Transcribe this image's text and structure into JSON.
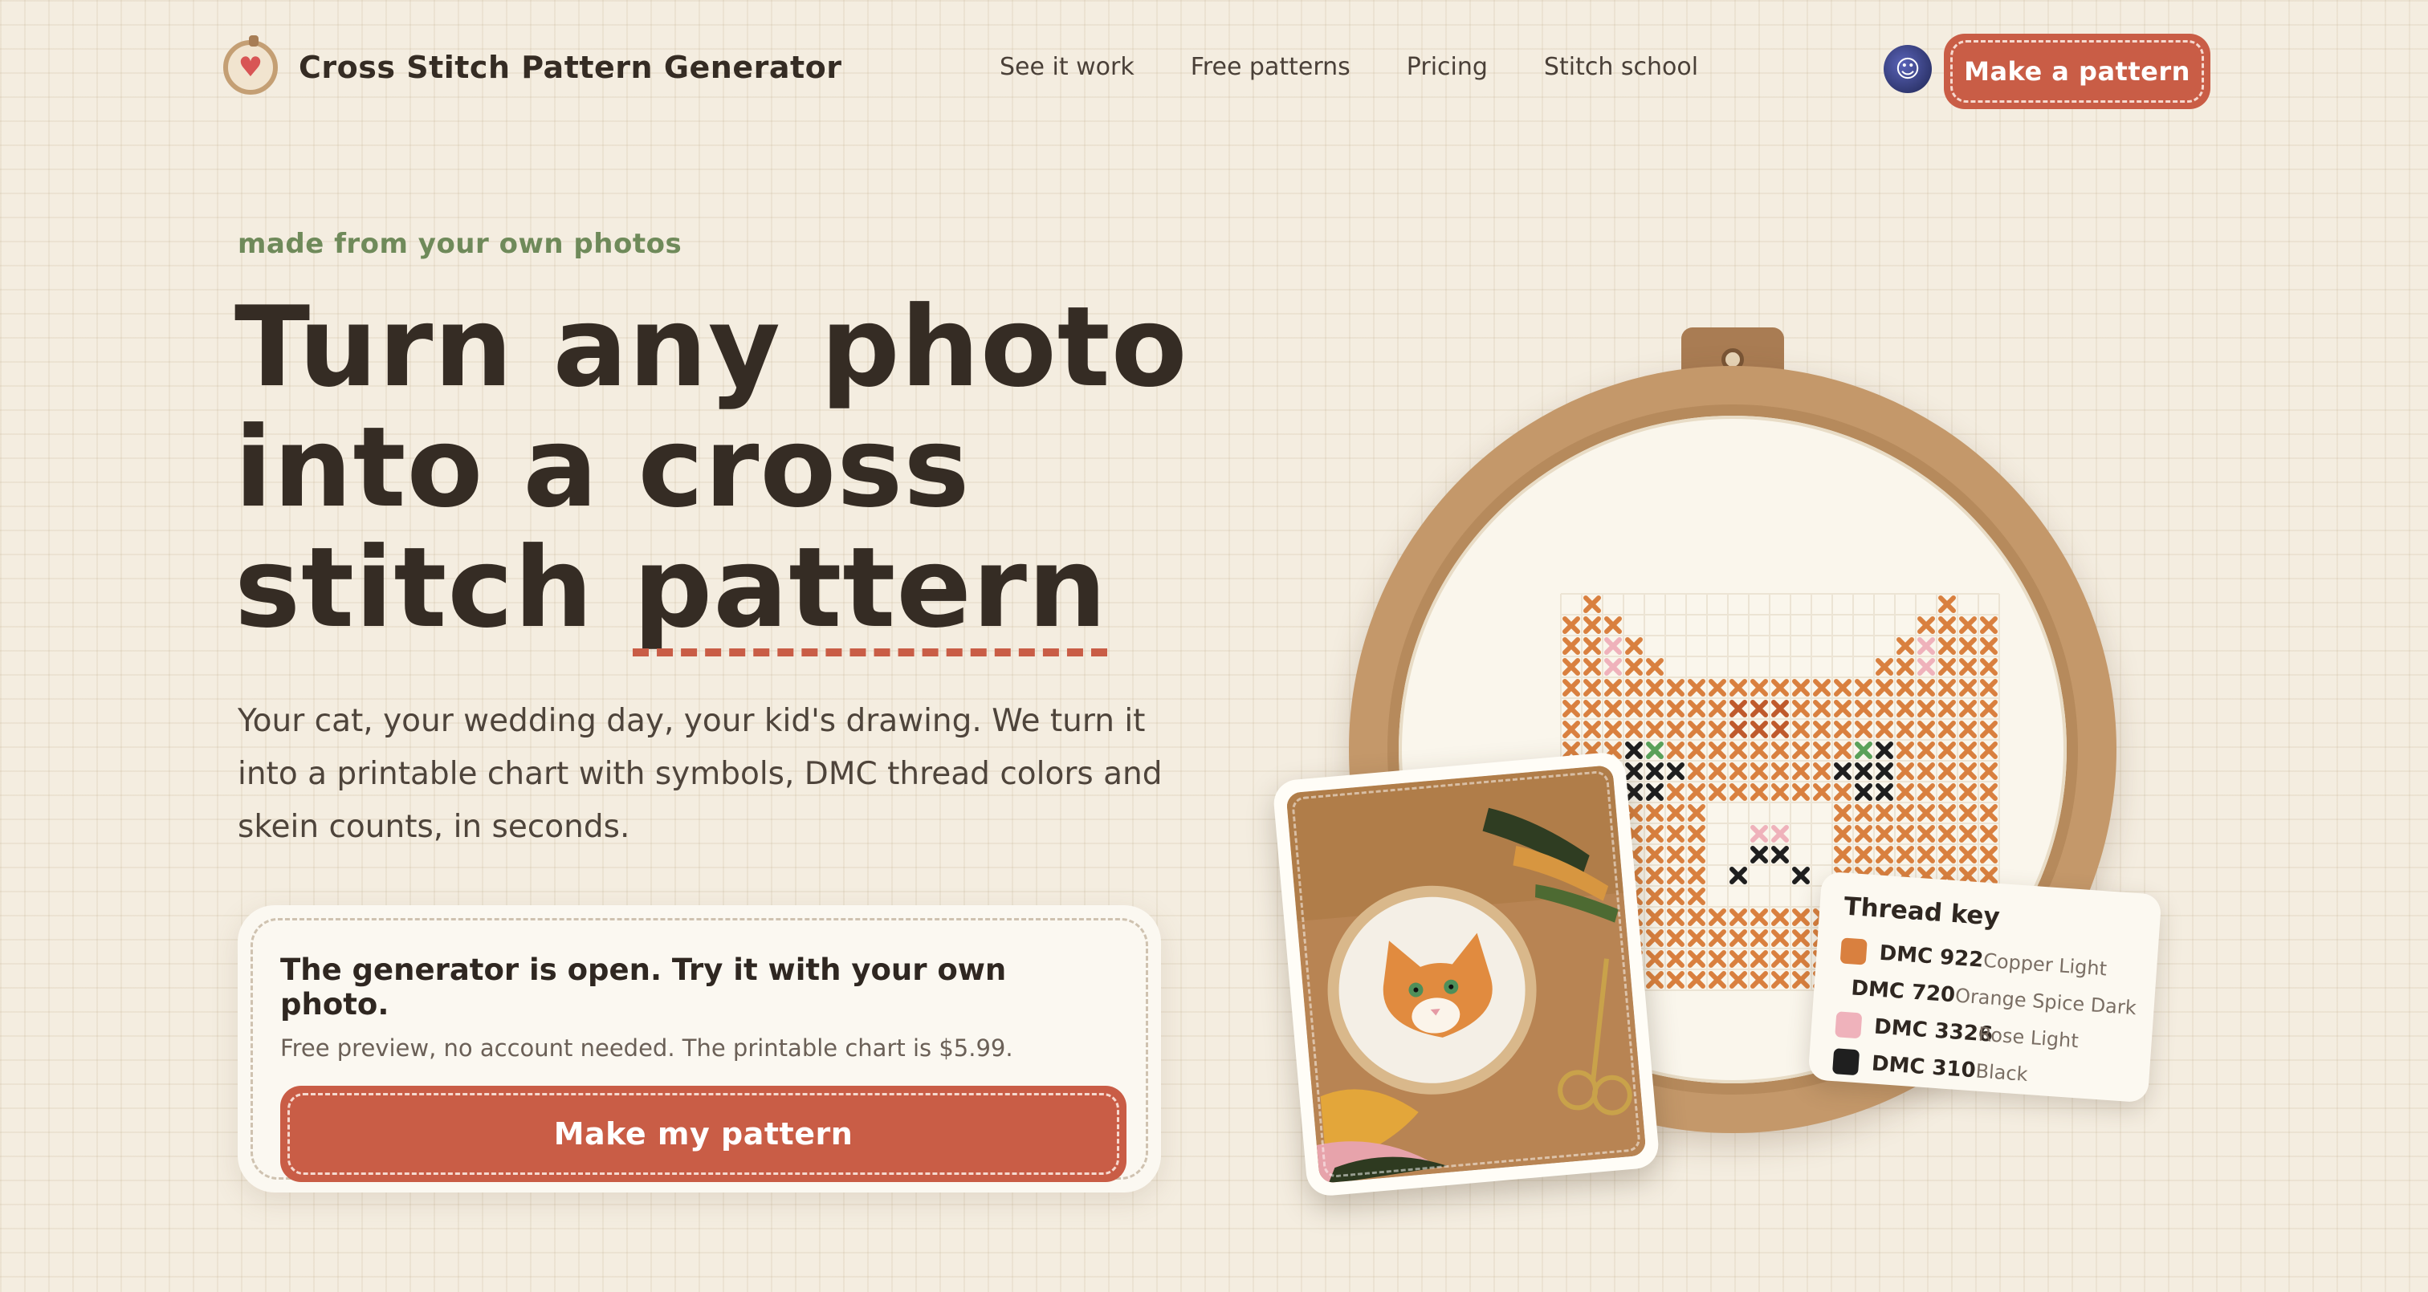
{
  "brand": {
    "name": "Cross Stitch Pattern Generator",
    "logo_icon": "heart-hoop-icon"
  },
  "nav": {
    "links": [
      "See it work",
      "Free patterns",
      "Pricing",
      "Stitch school"
    ],
    "cta": "Make a pattern",
    "avatar_icon": "astronaut-avatar-icon"
  },
  "hero": {
    "eyebrow": "made from your own photos",
    "headline_lines": [
      "Turn any photo",
      "into a cross",
      "stitch "
    ],
    "headline_underlined": "pattern",
    "subtitle": "Your cat, your wedding day, your kid's drawing. We turn it into a printable chart with symbols, DMC thread colors and skein counts, in seconds."
  },
  "card": {
    "title": "The generator is open. Try it with your own photo.",
    "subtitle": "Free preview, no account needed. The printable chart is $5.99.",
    "button": "Make my pattern"
  },
  "thread_key": {
    "title": "Thread key",
    "items": [
      {
        "code": "DMC 922",
        "name": "Copper Light",
        "color": "#d9803f"
      },
      {
        "code": "DMC 720",
        "name": "Orange Spice Dark",
        "color": "#bf5a2c"
      },
      {
        "code": "DMC 3326",
        "name": "Rose Light",
        "color": "#efb2bb"
      },
      {
        "code": "DMC 310",
        "name": "Black",
        "color": "#1f1f1f"
      }
    ]
  },
  "colors": {
    "accent": "#c95d46",
    "eyebrow": "#6f8a5a",
    "background": "#f4ede0"
  }
}
